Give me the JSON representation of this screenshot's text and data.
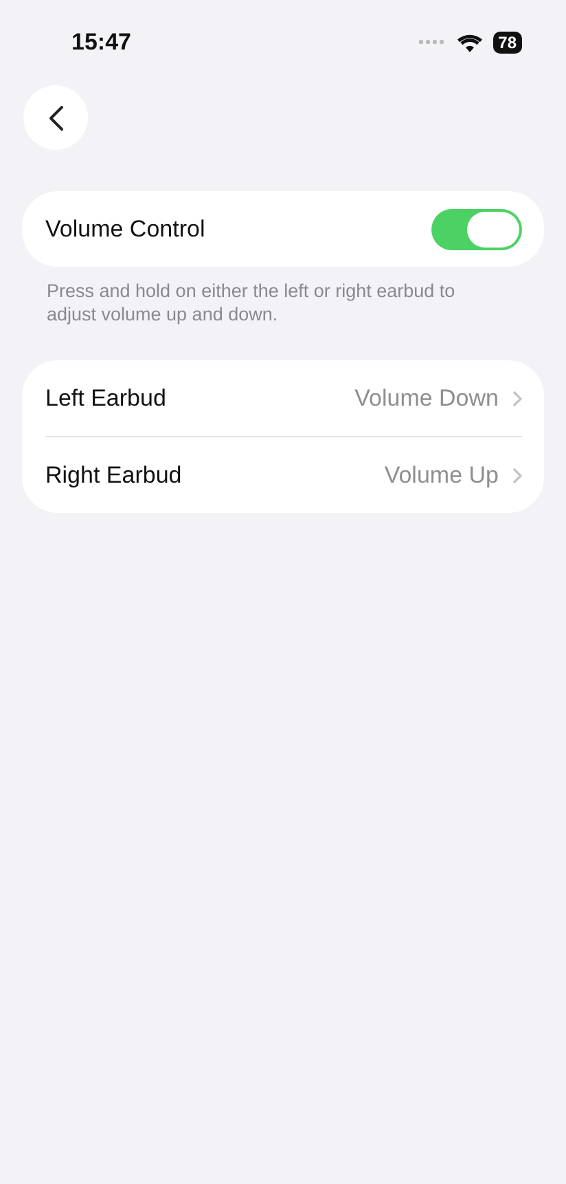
{
  "status_bar": {
    "time": "15:47",
    "battery": "78"
  },
  "toggle": {
    "label": "Volume Control",
    "on": true
  },
  "footnote": "Press and hold on either the left or right earbud to adjust volume up and down.",
  "rows": [
    {
      "label": "Left Earbud",
      "value": "Volume Down"
    },
    {
      "label": "Right Earbud",
      "value": "Volume Up"
    }
  ]
}
